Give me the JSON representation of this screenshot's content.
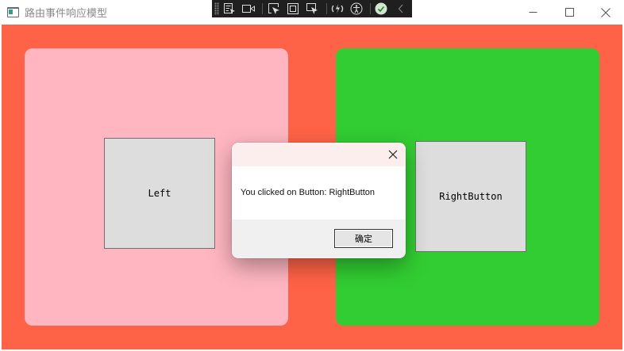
{
  "window": {
    "title": "路由事件响应模型"
  },
  "debug_toolbar": {
    "icons": [
      "select-element-icon",
      "video-icon",
      "select-pointer-icon",
      "display-layout-icon",
      "track-focus-icon",
      "hot-reload-icon",
      "accessibility-icon",
      "checkmark-icon",
      "collapse-chevron-icon"
    ]
  },
  "colors": {
    "background": "#ff6347",
    "left_panel": "#ffb6c1",
    "right_panel": "#32cd32",
    "button_face": "#dddddd"
  },
  "buttons": {
    "left_label": "Left",
    "right_label": "RightButton"
  },
  "dialog": {
    "message": "You clicked on Button: RightButton",
    "ok_label": "确定"
  }
}
